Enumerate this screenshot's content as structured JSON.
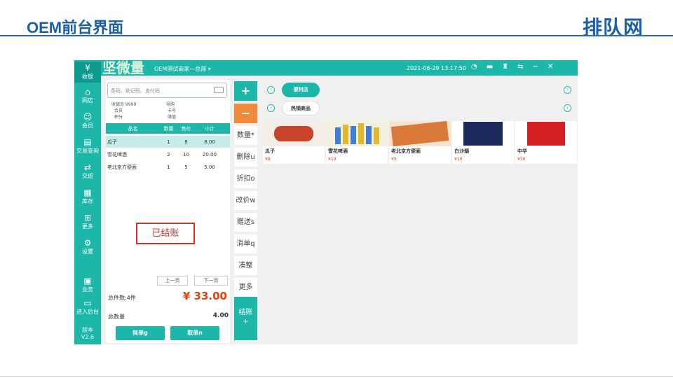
{
  "slide": {
    "title": "OEM前台界面",
    "brand": "排队网"
  },
  "topbar": {
    "logo": "坚微量",
    "store": "OEM测试商家—总部 ▾",
    "clock": "2021-06-29 13:17:50"
  },
  "sidebar": {
    "items": [
      {
        "label": "收银",
        "icon": "cashier-icon",
        "glyph": "¥"
      },
      {
        "label": "网店",
        "icon": "shop-icon",
        "glyph": "⌂"
      },
      {
        "label": "会员",
        "icon": "member-icon",
        "glyph": "☺"
      },
      {
        "label": "交易查询",
        "icon": "transaction-icon",
        "glyph": "▤"
      },
      {
        "label": "交班",
        "icon": "shift-icon",
        "glyph": "⇄"
      },
      {
        "label": "库存",
        "icon": "inventory-icon",
        "glyph": "▦"
      },
      {
        "label": "更多",
        "icon": "more-icon",
        "glyph": "⊞"
      },
      {
        "label": "设置",
        "icon": "settings-icon",
        "glyph": "⚙"
      },
      {
        "label": "业务",
        "icon": "business-icon",
        "glyph": "▣"
      },
      {
        "label": "进入后台",
        "icon": "backend-icon",
        "glyph": "▭"
      }
    ],
    "version_label": "版本",
    "version": "V2.6"
  },
  "cart": {
    "search_placeholder": "条码、助记码、支付码",
    "info": {
      "cashier": "收银员 9999",
      "guide": "导购",
      "member": "会员",
      "card": "卡号",
      "points": "积分",
      "stored": "储值"
    },
    "columns": [
      "品名",
      "数量",
      "售价",
      "小计"
    ],
    "rows": [
      {
        "name": "瓜子",
        "qty": "1",
        "price": "8",
        "subtotal": "8.00"
      },
      {
        "name": "雪花啤酒",
        "qty": "2",
        "price": "10",
        "subtotal": "20.00"
      },
      {
        "name": "老北京方便面",
        "qty": "1",
        "price": "5",
        "subtotal": "5.00"
      }
    ],
    "prev_page": "上一页",
    "next_page": "下一页",
    "total_items_label": "总件数:4件",
    "total_amount": "¥ 33.00",
    "total_qty_label": "总数量",
    "total_qty": "4.00",
    "hold_button": "挂单g",
    "retrieve_button": "取单n"
  },
  "status_stamp": "已结账",
  "ops": {
    "plus": "+",
    "minus": "−",
    "buttons": [
      "数量*",
      "删除u",
      "折扣o",
      "改价w",
      "赠送s",
      "消单q",
      "凑整",
      "更多"
    ],
    "settle": "结账",
    "settle_sub": "+"
  },
  "categories": {
    "store_pill": "便利店",
    "hot_pill": "热销商品"
  },
  "products": [
    {
      "name": "瓜子",
      "price": "¥8",
      "color": "#c8432a"
    },
    {
      "name": "雪花啤酒",
      "price": "¥10",
      "color": "#e3b82a"
    },
    {
      "name": "老北京方便面",
      "price": "¥5",
      "color": "#d97a3a"
    },
    {
      "name": "白沙烟",
      "price": "¥10",
      "color": "#1c2a5e"
    },
    {
      "name": "中华",
      "price": "¥50",
      "color": "#d42020"
    }
  ],
  "colors": {
    "accent": "#1cb7a8",
    "orange": "#f08a3c",
    "price_red": "#e8420f",
    "stamp_red": "#d93020"
  }
}
